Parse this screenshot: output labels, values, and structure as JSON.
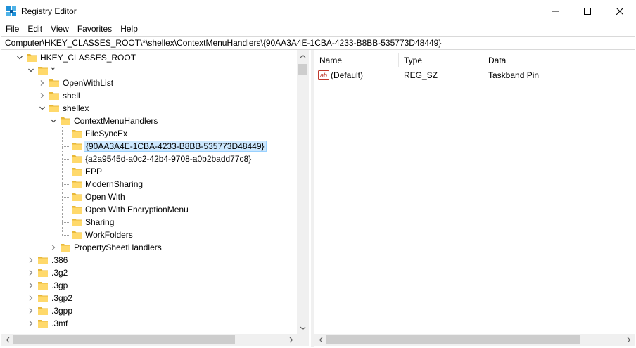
{
  "window": {
    "title": "Registry Editor",
    "icon": "registry-editor-icon",
    "controls": [
      "minimize-icon",
      "maximize-icon",
      "close-icon"
    ]
  },
  "menu": [
    "File",
    "Edit",
    "View",
    "Favorites",
    "Help"
  ],
  "address": "Computer\\HKEY_CLASSES_ROOT\\*\\shellex\\ContextMenuHandlers\\{90AA3A4E-1CBA-4233-B8BB-535773D48449}",
  "tree": [
    {
      "label": "HKEY_CLASSES_ROOT",
      "depth": 0,
      "expanded": true,
      "selected": false
    },
    {
      "label": "*",
      "depth": 1,
      "expanded": true,
      "selected": false
    },
    {
      "label": "OpenWithList",
      "depth": 2,
      "expanded": false,
      "selected": false
    },
    {
      "label": "shell",
      "depth": 2,
      "expanded": false,
      "selected": false
    },
    {
      "label": "shellex",
      "depth": 2,
      "expanded": true,
      "selected": false
    },
    {
      "label": "ContextMenuHandlers",
      "depth": 3,
      "expanded": true,
      "selected": false
    },
    {
      "label": "FileSyncEx",
      "depth": 4,
      "expanded": null,
      "selected": false
    },
    {
      "label": "{90AA3A4E-1CBA-4233-B8BB-535773D48449}",
      "depth": 4,
      "expanded": null,
      "selected": true
    },
    {
      "label": "{a2a9545d-a0c2-42b4-9708-a0b2badd77c8}",
      "depth": 4,
      "expanded": null,
      "selected": false
    },
    {
      "label": "EPP",
      "depth": 4,
      "expanded": null,
      "selected": false
    },
    {
      "label": "ModernSharing",
      "depth": 4,
      "expanded": null,
      "selected": false
    },
    {
      "label": "Open With",
      "depth": 4,
      "expanded": null,
      "selected": false
    },
    {
      "label": "Open With EncryptionMenu",
      "depth": 4,
      "expanded": null,
      "selected": false
    },
    {
      "label": "Sharing",
      "depth": 4,
      "expanded": null,
      "selected": false
    },
    {
      "label": "WorkFolders",
      "depth": 4,
      "expanded": null,
      "selected": false
    },
    {
      "label": "PropertySheetHandlers",
      "depth": 3,
      "expanded": false,
      "selected": false
    },
    {
      "label": ".386",
      "depth": 1,
      "expanded": false,
      "selected": false
    },
    {
      "label": ".3g2",
      "depth": 1,
      "expanded": false,
      "selected": false
    },
    {
      "label": ".3gp",
      "depth": 1,
      "expanded": false,
      "selected": false
    },
    {
      "label": ".3gp2",
      "depth": 1,
      "expanded": false,
      "selected": false
    },
    {
      "label": ".3gpp",
      "depth": 1,
      "expanded": false,
      "selected": false
    },
    {
      "label": ".3mf",
      "depth": 1,
      "expanded": false,
      "selected": false
    }
  ],
  "list": {
    "columns": [
      "Name",
      "Type",
      "Data"
    ],
    "rows": [
      {
        "icon": "string-value-icon",
        "name": "(Default)",
        "type": "REG_SZ",
        "data": "Taskband Pin"
      }
    ]
  },
  "colors": {
    "selection_bg": "#cce8ff",
    "selection_border": "#99d1ff",
    "folder": "#ffd96b",
    "folder_dark": "#e8b838"
  }
}
